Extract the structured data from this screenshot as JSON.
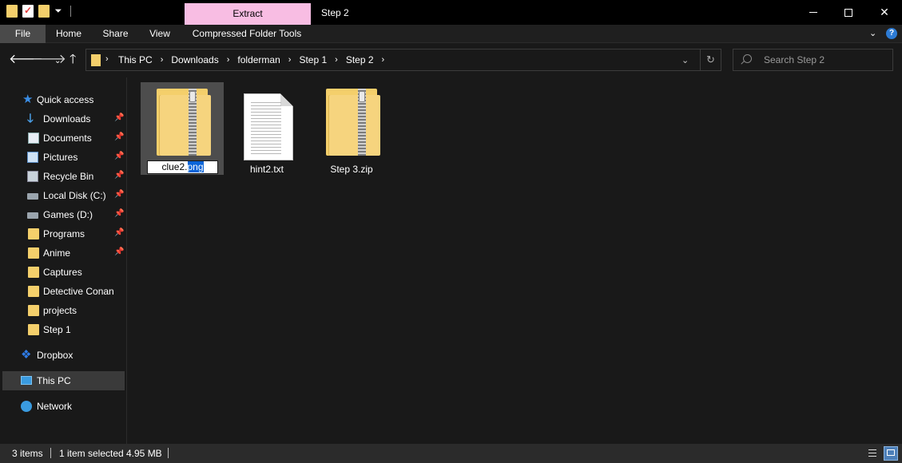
{
  "window": {
    "title": "Step 2",
    "context_tab_header": "Extract",
    "controls": {
      "minimize": "minimize",
      "maximize": "maximize",
      "close": "✕"
    }
  },
  "ribbon": {
    "tabs": [
      "File",
      "Home",
      "Share",
      "View",
      "Compressed Folder Tools"
    ],
    "help": "?"
  },
  "address": {
    "crumbs": [
      "This PC",
      "Downloads",
      "folderman",
      "Step 1",
      "Step 2"
    ],
    "search_placeholder": "Search Step 2"
  },
  "sidebar": {
    "quick_access": "Quick access",
    "items": [
      {
        "label": "Downloads",
        "icon": "download-icon",
        "pinned": true
      },
      {
        "label": "Documents",
        "icon": "documents-icon",
        "pinned": true
      },
      {
        "label": "Pictures",
        "icon": "pictures-icon",
        "pinned": true
      },
      {
        "label": "Recycle Bin",
        "icon": "recycle-bin-icon",
        "pinned": true
      },
      {
        "label": "Local Disk (C:)",
        "icon": "local-disk-icon",
        "pinned": true
      },
      {
        "label": "Games (D:)",
        "icon": "drive-icon",
        "pinned": true
      },
      {
        "label": "Programs",
        "icon": "folder-icon",
        "pinned": true
      },
      {
        "label": "Anime",
        "icon": "folder-icon",
        "pinned": true
      },
      {
        "label": "Captures",
        "icon": "folder-icon",
        "pinned": false
      },
      {
        "label": "Detective Conan",
        "icon": "folder-icon",
        "pinned": false
      },
      {
        "label": "projects",
        "icon": "folder-icon",
        "pinned": false
      },
      {
        "label": "Step 1",
        "icon": "folder-icon",
        "pinned": false
      }
    ],
    "dropbox": "Dropbox",
    "this_pc": "This PC",
    "network": "Network"
  },
  "files": [
    {
      "name": "clue2.png",
      "rename_base": "clue2.",
      "rename_selected": "png",
      "type": "zip",
      "selected": true,
      "renaming": true
    },
    {
      "name": "hint2.txt",
      "type": "text",
      "selected": false
    },
    {
      "name": "Step 3.zip",
      "type": "zip",
      "selected": false
    }
  ],
  "status": {
    "items_count": "3 items",
    "selection": "1 item selected",
    "size": "4.95 MB"
  },
  "colors": {
    "context_tab": "#f8bde3",
    "folder": "#f4cf6b",
    "selection": "#0a64d8",
    "accent": "#2d7bd4"
  }
}
